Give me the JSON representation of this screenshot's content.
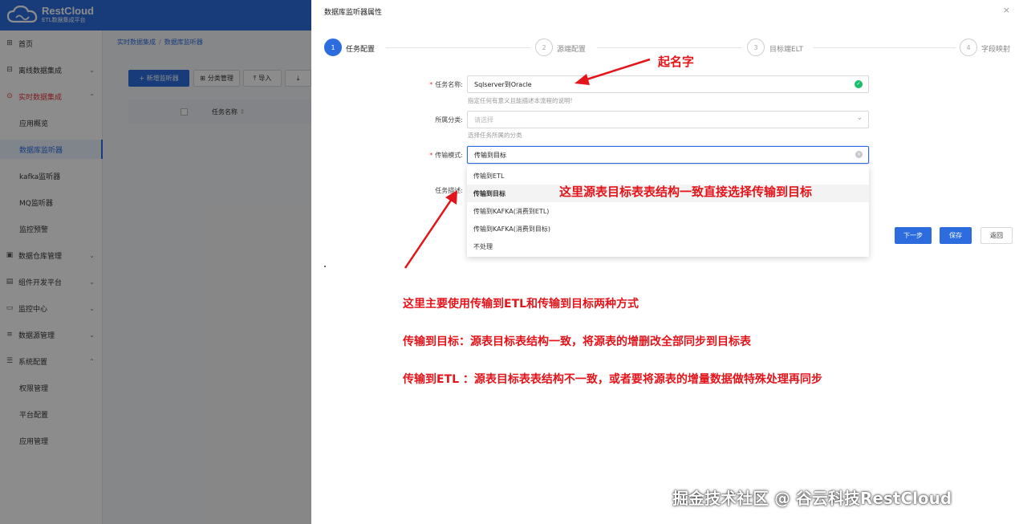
{
  "app": {
    "logo_title": "RestCloud",
    "logo_subtitle": "ETL数据集成平台",
    "brand_color": "#2d6cdf"
  },
  "sidebar": {
    "items": [
      {
        "label": "首页",
        "icon": "home-icon"
      },
      {
        "label": "离线数据集成",
        "icon": "offline-icon"
      },
      {
        "label": "实时数据集成",
        "icon": "realtime-icon"
      },
      {
        "label": "应用概览"
      },
      {
        "label": "数据库监听器"
      },
      {
        "label": "kafka监听器"
      },
      {
        "label": "MQ监听器"
      },
      {
        "label": "监控预警"
      },
      {
        "label": "数据仓库管理",
        "icon": "warehouse-icon"
      },
      {
        "label": "组件开发平台",
        "icon": "component-icon"
      },
      {
        "label": "监控中心",
        "icon": "monitor-icon"
      },
      {
        "label": "数据源管理",
        "icon": "datasource-icon"
      },
      {
        "label": "系统配置",
        "icon": "settings-icon"
      },
      {
        "label": "权限管理"
      },
      {
        "label": "平台配置"
      },
      {
        "label": "应用管理"
      }
    ]
  },
  "content": {
    "breadcrumb": [
      "实时数据集成",
      "数据库监听器"
    ],
    "toolbar": {
      "add_label": "+ 新增监听器",
      "category_label": "分类管理",
      "import_label": "导入"
    },
    "table_header_name": "任务名称"
  },
  "drawer": {
    "title": "数据库监听器属性",
    "close": "×",
    "steps": [
      {
        "num": "1",
        "label": "任务配置"
      },
      {
        "num": "2",
        "label": "源端配置"
      },
      {
        "num": "3",
        "label": "目标端ELT"
      },
      {
        "num": "4",
        "label": "字段映射"
      }
    ],
    "form": {
      "task_name_label": "任务名称:",
      "task_name_value": "Sqlserver到Oracle",
      "task_name_hint": "指定任何有意义且能描述本流程的说明!",
      "category_label": "所属分类:",
      "category_placeholder": "请选择",
      "category_hint": "选择任务所属的分类",
      "mode_label": "传输模式:",
      "mode_value": "传输到目标",
      "desc_label": "任务描述:"
    },
    "dropdown_options": [
      "传输到ETL",
      "传输到目标",
      "传输到KAFKA(消费到ETL)",
      "传输到KAFKA(消费到目标)",
      "不处理"
    ],
    "buttons": {
      "next": "下一步",
      "save": "保存",
      "back": "返回"
    }
  },
  "annotations": {
    "name_note": "起名字",
    "select_note": "这里源表目标表表结构一致直接选择传输到目标",
    "line1": "这里主要使用传输到ETL和传输到目标两种方式",
    "line2": "传输到目标：源表目标表结构一致，将源表的增删改全部同步到目标表",
    "line3": "传输到ETL ：源表目标表表结构不一致，或者要将源表的增量数据做特殊处理再同步",
    "color": "#e4141b"
  },
  "watermark": "掘金技术社区 @ 谷云科技RestCloud"
}
